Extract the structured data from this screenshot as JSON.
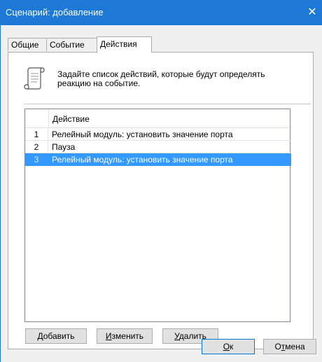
{
  "window": {
    "title": "Сценарий: добавление",
    "close_glyph": "✕",
    "accent_color": "#1d78d6"
  },
  "tabs": [
    {
      "label": "Общие",
      "active": false
    },
    {
      "label": "Событие",
      "active": false
    },
    {
      "label": "Действия",
      "active": true
    }
  ],
  "panel": {
    "icon": "scroll-icon",
    "info_line1": "Задайте список действий, которые будут определять",
    "info_line2": "реакцию на событие."
  },
  "actions_list": {
    "column_header": "Действие",
    "rows": [
      {
        "num": "1",
        "text": "Релейный модуль: установить значение порта",
        "selected": false
      },
      {
        "num": "2",
        "text": "Пауза",
        "selected": false
      },
      {
        "num": "3",
        "text": "Релейный модуль: установить значение порта",
        "selected": true
      }
    ],
    "selection_color": "#3399ff"
  },
  "list_buttons": {
    "add": {
      "mnemonic": "Д",
      "rest": "обавить"
    },
    "edit": {
      "mnemonic": "И",
      "rest": "зменить"
    },
    "delete": {
      "mnemonic": "У",
      "rest": "далить"
    }
  },
  "dialog_buttons": {
    "ok": {
      "mnemonic": "О",
      "rest": "к"
    },
    "cancel": {
      "pre": "О",
      "mnemonic": "т",
      "rest": "мена"
    }
  }
}
